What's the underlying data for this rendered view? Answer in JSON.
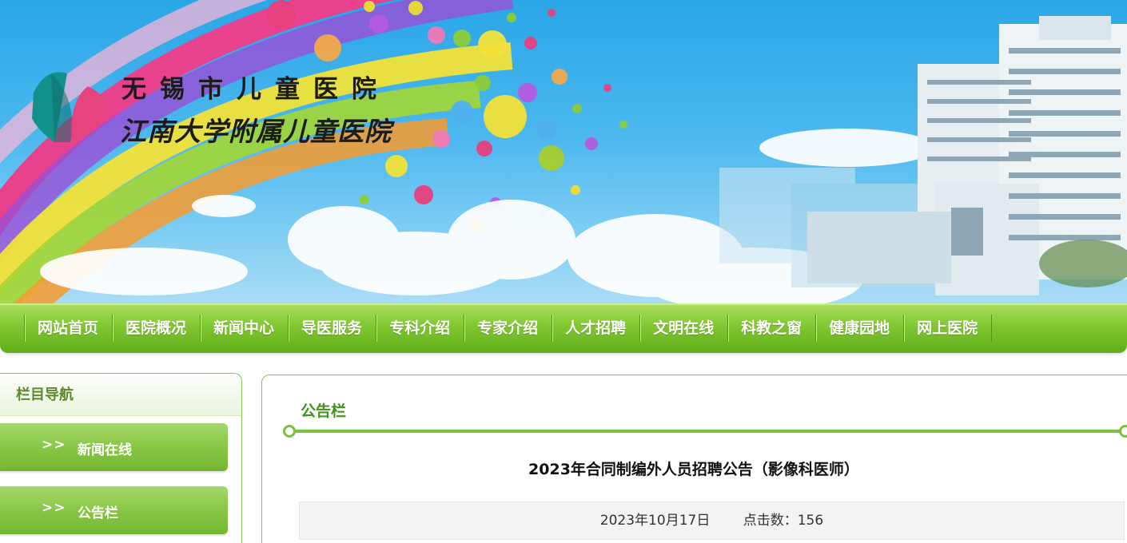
{
  "header": {
    "hospital_name": "无锡市儿童医院",
    "hospital_subname": "江南大学附属儿童医院",
    "colors": {
      "sky": "#3bb1ea",
      "logo_pink": "#e7447f",
      "logo_teal": "#12918a"
    }
  },
  "nav": {
    "items": [
      {
        "label": "网站首页"
      },
      {
        "label": "医院概况"
      },
      {
        "label": "新闻中心"
      },
      {
        "label": "导医服务"
      },
      {
        "label": "专科介绍"
      },
      {
        "label": "专家介绍"
      },
      {
        "label": "人才招聘"
      },
      {
        "label": "文明在线"
      },
      {
        "label": "科教之窗"
      },
      {
        "label": "健康园地"
      },
      {
        "label": "网上医院"
      }
    ],
    "color": "#76bd2c"
  },
  "sidebar": {
    "title": "栏目导航",
    "items": [
      {
        "arrow": ">>",
        "label": "新闻在线"
      },
      {
        "arrow": ">>",
        "label": "公告栏"
      }
    ]
  },
  "main": {
    "section_title": "公告栏",
    "article_title": "2023年合同制编外人员招聘公告（影像科医师）",
    "date": "2023年10月17日",
    "hits": "点击数：156",
    "accent_color": "#3d9418"
  }
}
